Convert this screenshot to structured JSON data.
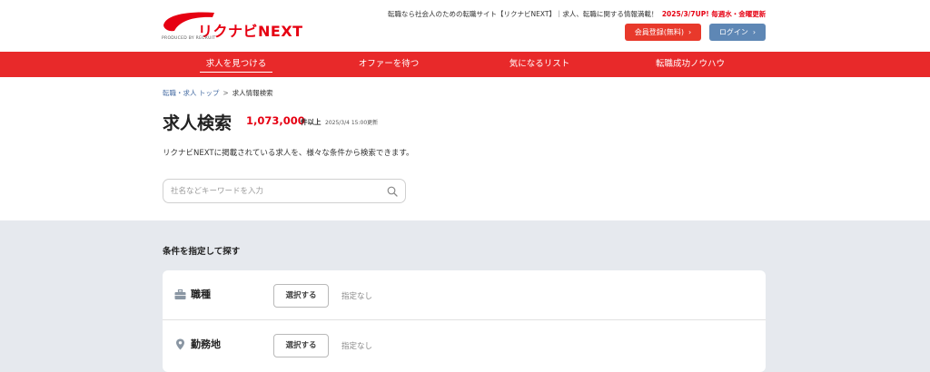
{
  "header": {
    "logo_text": "リクナビNEXT",
    "logo_byline": "PRODUCED BY RECRUIT",
    "tagline": "転職なら社会人のための転職サイト【リクナビNEXT】｜求人、転職に関する情報満載！",
    "update_notice": "2025/3/7UP! 毎週水・金曜更新",
    "register_label": "会員登録(無料)",
    "login_label": "ログイン",
    "brand_color": "#e60012"
  },
  "nav": {
    "items": [
      {
        "label": "求人を見つける",
        "active": true
      },
      {
        "label": "オファーを待つ",
        "active": false
      },
      {
        "label": "気になるリスト",
        "active": false
      },
      {
        "label": "転職成功ノウハウ",
        "active": false
      }
    ]
  },
  "breadcrumb": {
    "home": "転職・求人 トップ",
    "separator": ">",
    "current": "求人情報検索"
  },
  "main": {
    "title": "求人検索",
    "count": "1,073,000",
    "count_suffix": "件以上",
    "updated": "2025/3/4 15:00更新",
    "description": "リクナビNEXTに掲載されている求人を、様々な条件から検索できます。",
    "search_placeholder": "社名などキーワードを入力"
  },
  "conditions": {
    "title": "条件を指定して探す",
    "rows": [
      {
        "icon": "briefcase-icon",
        "label": "職種",
        "button": "選択する",
        "value": "指定なし"
      },
      {
        "icon": "location-pin-icon",
        "label": "勤務地",
        "button": "選択する",
        "value": "指定なし"
      }
    ]
  }
}
